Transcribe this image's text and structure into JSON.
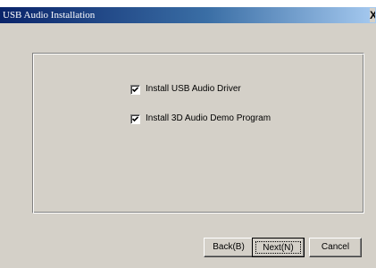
{
  "window": {
    "title": "USB Audio Installation",
    "close_glyph": "X"
  },
  "options": [
    {
      "label": "Install USB Audio Driver",
      "checked": true
    },
    {
      "label": "Install 3D Audio Demo Program",
      "checked": true
    }
  ],
  "buttons": {
    "back": "Back(B)",
    "next": "Next(N)",
    "cancel": "Cancel"
  },
  "colors": {
    "dialog_face": "#d4d0c8",
    "titlebar_start": "#0a246a",
    "titlebar_end": "#a6caf0"
  }
}
